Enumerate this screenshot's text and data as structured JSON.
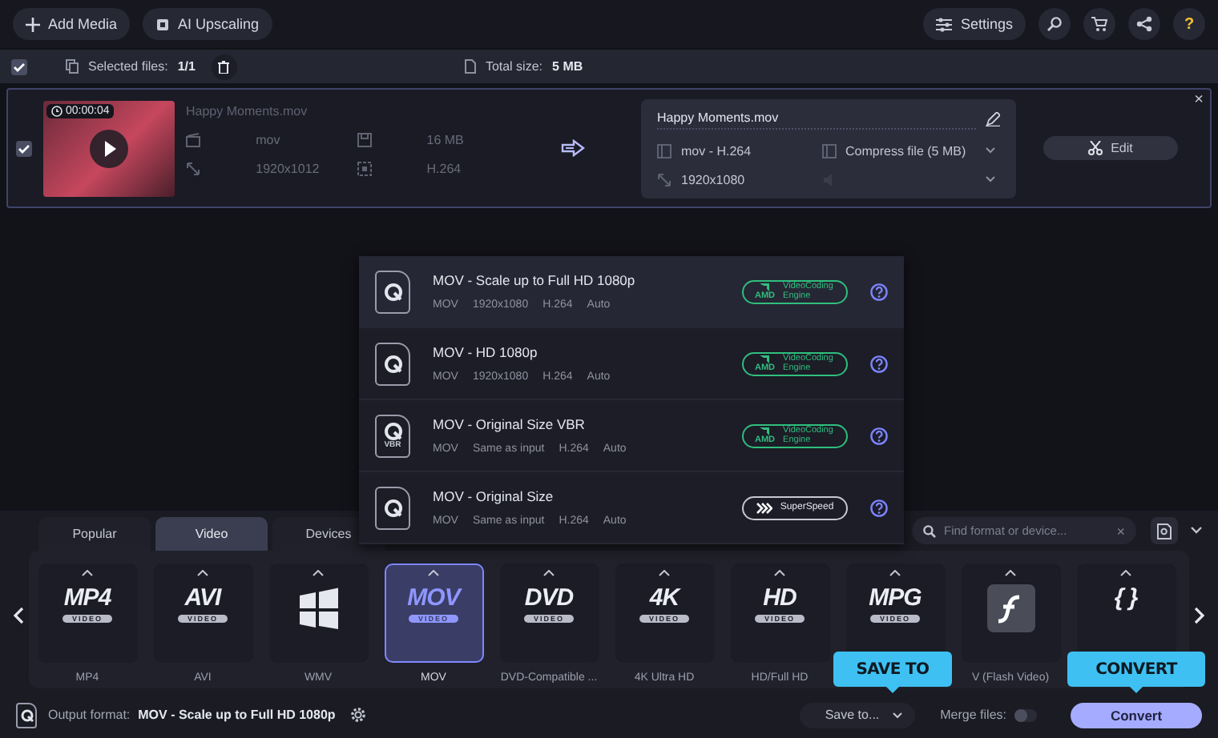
{
  "toolbar": {
    "add_media": "Add Media",
    "ai_upscaling": "AI Upscaling",
    "settings": "Settings",
    "help": "?"
  },
  "selection_bar": {
    "select_all_checked": true,
    "selected_label": "Selected files:",
    "selected_count": "1/1",
    "total_label": "Total size:",
    "total_value": "5 MB"
  },
  "file": {
    "checked": true,
    "duration": "00:00:04",
    "name": "Happy Moments.mov",
    "format": "mov",
    "size": "16 MB",
    "resolution": "1920x1012",
    "codec": "H.264",
    "output": {
      "name": "Happy Moments.mov",
      "format": "mov - H.264",
      "compression": "Compress file (5 MB)",
      "resolution": "1920x1080"
    },
    "edit": "Edit",
    "close": "×"
  },
  "preset_menu": [
    {
      "title": "MOV - Scale up to Full HD 1080p",
      "specs": [
        "MOV",
        "1920x1080",
        "H.264",
        "Auto"
      ],
      "badge": {
        "kind": "amd",
        "brand": "AMD",
        "text": "VideoCoding Engine"
      },
      "selected": true
    },
    {
      "title": "MOV - HD 1080p",
      "specs": [
        "MOV",
        "1920x1080",
        "H.264",
        "Auto"
      ],
      "badge": {
        "kind": "amd",
        "brand": "AMD",
        "text": "VideoCoding Engine"
      },
      "selected": false
    },
    {
      "title": "MOV - Original Size VBR",
      "icon_label": "VBR",
      "specs": [
        "MOV",
        "Same as input",
        "H.264",
        "Auto"
      ],
      "badge": {
        "kind": "amd",
        "brand": "AMD",
        "text": "VideoCoding Engine"
      },
      "selected": false
    },
    {
      "title": "MOV - Original Size",
      "specs": [
        "MOV",
        "Same as input",
        "H.264",
        "Auto"
      ],
      "badge": {
        "kind": "superspeed",
        "text": "SuperSpeed"
      },
      "selected": false
    }
  ],
  "format_tabs": [
    {
      "label": "Popular",
      "selected": false
    },
    {
      "label": "Video",
      "selected": true
    },
    {
      "label": "Devices",
      "selected": false
    }
  ],
  "search": {
    "placeholder": "Find format or device...",
    "clear": "×"
  },
  "formats": [
    {
      "kind": "logo",
      "logo": "MP4",
      "sub": "VIDEO",
      "label": "MP4",
      "selected": false
    },
    {
      "kind": "logo",
      "logo": "AVI",
      "sub": "VIDEO",
      "label": "AVI",
      "selected": false
    },
    {
      "kind": "windows",
      "label": "WMV",
      "selected": false
    },
    {
      "kind": "logo",
      "logo": "MOV",
      "sub": "VIDEO",
      "label": "MOV",
      "selected": true
    },
    {
      "kind": "logo",
      "logo": "DVD",
      "sub": "VIDEO",
      "label": "DVD-Compatible ...",
      "selected": false
    },
    {
      "kind": "logo",
      "logo": "4K",
      "sub": "VIDEO",
      "label": "4K Ultra HD",
      "selected": false
    },
    {
      "kind": "logo",
      "logo": "HD",
      "sub": "VIDEO",
      "label": "HD/Full HD",
      "selected": false
    },
    {
      "kind": "logo",
      "logo": "MPG",
      "sub": "VIDEO",
      "selected": false
    },
    {
      "kind": "flash",
      "label": "V (Flash Video)",
      "selected": false
    },
    {
      "kind": "logo",
      "logo": "{ }",
      "selected": false
    }
  ],
  "bottom_bar": {
    "output_label": "Output format:",
    "output_value": "MOV - Scale up to Full HD 1080p",
    "save_to": "Save to...",
    "merge_label": "Merge files:",
    "merge_on": false,
    "convert": "Convert"
  },
  "callouts": [
    {
      "kind": "save_to",
      "text": "SAVE TO"
    },
    {
      "kind": "convert",
      "text": "CONVERT"
    }
  ]
}
